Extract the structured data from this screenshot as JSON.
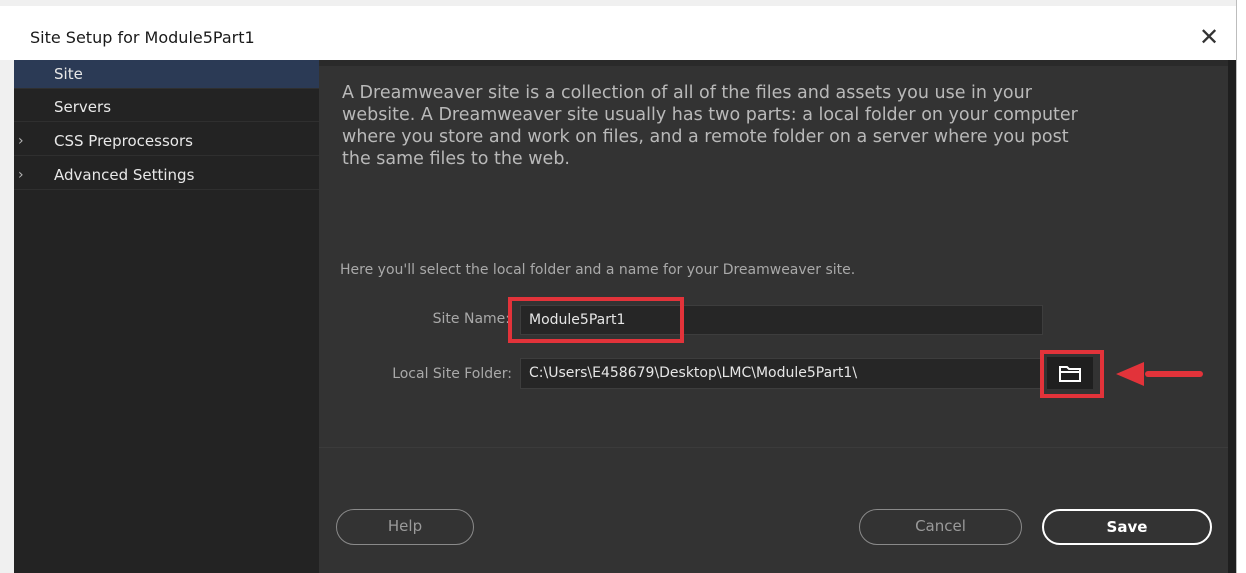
{
  "window": {
    "title": "Site Setup for Module5Part1",
    "close_glyph": "✕"
  },
  "sidebar": {
    "items": [
      {
        "label": "Site",
        "chevron": "",
        "active": true
      },
      {
        "label": "Servers",
        "chevron": "",
        "active": false
      },
      {
        "label": "CSS Preprocessors",
        "chevron": "›",
        "active": false
      },
      {
        "label": "Advanced Settings",
        "chevron": "›",
        "active": false
      }
    ]
  },
  "main": {
    "intro_lines": [
      "A Dreamweaver site is a collection of all of the files and assets you use in your",
      "website. A Dreamweaver site usually has two parts: a local folder on your computer",
      "where you store and work on files, and a remote folder on a server where you post",
      "the same files to the web."
    ],
    "hint": "Here you'll select the local folder and a name for your Dreamweaver site.",
    "site_name": {
      "label": "Site Name:",
      "value": "Module5Part1"
    },
    "local_folder": {
      "label": "Local Site Folder:",
      "value": "C:\\Users\\E458679\\Desktop\\LMC\\Module5Part1\\"
    }
  },
  "buttons": {
    "help": "Help",
    "cancel": "Cancel",
    "save": "Save"
  },
  "icons": {
    "folder": "folder-icon",
    "close": "close-icon",
    "chevron": "chevron-right-icon",
    "arrow": "left-arrow-icon"
  },
  "colors": {
    "highlight": "#e2333a",
    "active_nav": "#2b3a55",
    "panel": "#333333",
    "sidebar": "#232323"
  }
}
